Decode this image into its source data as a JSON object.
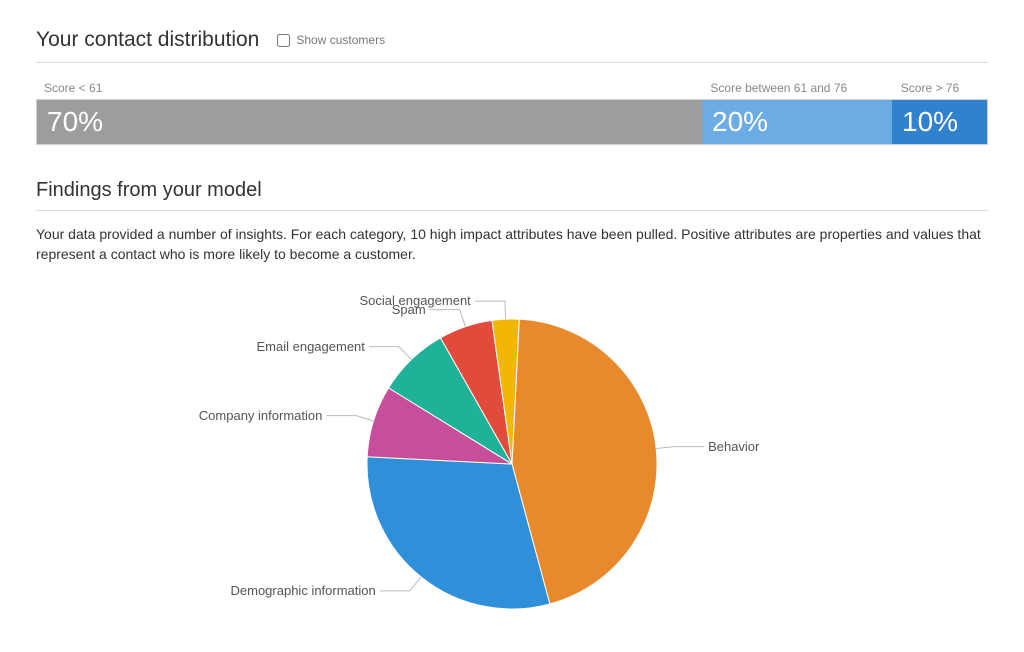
{
  "distribution": {
    "title": "Your contact distribution",
    "checkbox_label": "Show customers",
    "segments": [
      {
        "label": "Score < 61",
        "value_text": "70%",
        "pct": 70,
        "class": "seg-low"
      },
      {
        "label": "Score between 61 and 76",
        "value_text": "20%",
        "pct": 20,
        "class": "seg-mid"
      },
      {
        "label": "Score > 76",
        "value_text": "10%",
        "pct": 10,
        "class": "seg-high"
      }
    ]
  },
  "findings": {
    "title": "Findings from your model",
    "description": "Your data provided a number of insights. For each category, 10 high impact attributes have been pulled. Positive attributes are properties and values that represent a contact who is more likely to become a customer."
  },
  "chart_data": {
    "type": "pie",
    "title": "",
    "series": [
      {
        "name": "Behavior",
        "value": 45,
        "color": "#e8892b"
      },
      {
        "name": "Demographic information",
        "value": 30,
        "color": "#2f8fd8"
      },
      {
        "name": "Company information",
        "value": 8,
        "color": "#c84e9b"
      },
      {
        "name": "Email engagement",
        "value": 8,
        "color": "#1fb299"
      },
      {
        "name": "Spam",
        "value": 6,
        "color": "#e24a3b"
      },
      {
        "name": "Social engagement",
        "value": 3,
        "color": "#f2b705"
      }
    ]
  }
}
